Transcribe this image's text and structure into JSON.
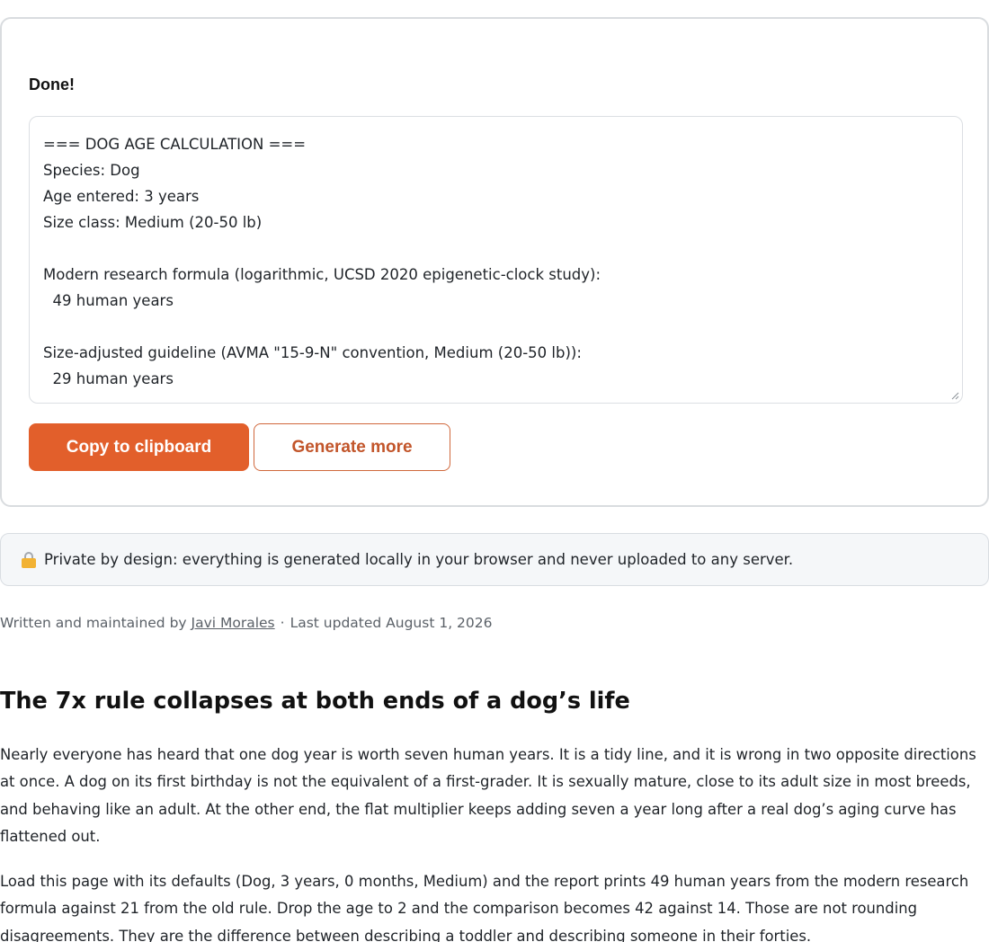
{
  "result": {
    "status": "Done!",
    "output_lines": [
      "=== DOG AGE CALCULATION ===",
      "Species: Dog",
      "Age entered: 3 years",
      "Size class: Medium (20-50 lb)",
      "",
      "Modern research formula (logarithmic, UCSD 2020 epigenetic-clock study):",
      "  49 human years",
      "",
      "Size-adjusted guideline (AVMA \"15-9-N\" convention, Medium (20-50 lb)):",
      "  29 human years"
    ],
    "copy_label": "Copy to clipboard",
    "more_label": "Generate more"
  },
  "privacy": {
    "icon": "lock-icon",
    "text": "Private by design: everything is generated locally in your browser and never uploaded to any server."
  },
  "byline": {
    "prefix": "Written and maintained by ",
    "author": "Javi Morales",
    "separator": "·",
    "updated": "Last updated August 1, 2026"
  },
  "article": {
    "title": "The 7x rule collapses at both ends of a dog’s life",
    "paragraphs": [
      "Nearly everyone has heard that one dog year is worth seven human years. It is a tidy line, and it is wrong in two opposite directions at once. A dog on its first birthday is not the equivalent of a first-grader. It is sexually mature, close to its adult size in most breeds, and behaving like an adult. At the other end, the flat multiplier keeps adding seven a year long after a real dog’s aging curve has flattened out.",
      "Load this page with its defaults (Dog, 3 years, 0 months, Medium) and the report prints 49 human years from the modern research formula against 21 from the old rule. Drop the age to 2 and the comparison becomes 42 against 14. Those are not rounding disagreements. They are the difference between describing a toddler and describing someone in their forties."
    ]
  },
  "colors": {
    "accent": "#e25f2b",
    "accent_text": "#c2552a"
  }
}
